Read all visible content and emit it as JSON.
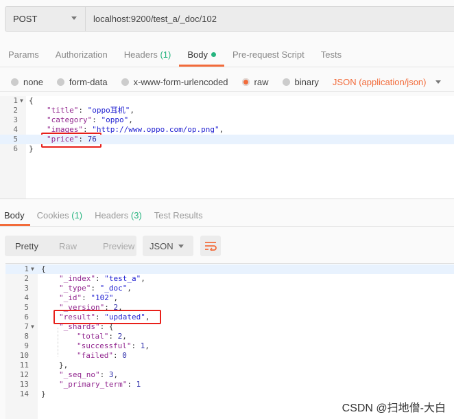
{
  "request": {
    "method": "POST",
    "url": "localhost:9200/test_a/_doc/102"
  },
  "request_tabs": [
    {
      "label": "Params",
      "count": ""
    },
    {
      "label": "Authorization",
      "count": ""
    },
    {
      "label": "Headers",
      "count": "(1)"
    },
    {
      "label": "Body",
      "count": "",
      "active": true,
      "dot": true
    },
    {
      "label": "Pre-request Script",
      "count": ""
    },
    {
      "label": "Tests",
      "count": ""
    }
  ],
  "body_types": [
    {
      "label": "none"
    },
    {
      "label": "form-data"
    },
    {
      "label": "x-www-form-urlencoded"
    },
    {
      "label": "raw",
      "selected": true
    },
    {
      "label": "binary"
    }
  ],
  "content_type": "JSON (application/json)",
  "request_body": [
    {
      "n": "1",
      "fold": true,
      "i": 0,
      "p": "{"
    },
    {
      "n": "2",
      "i": 1,
      "k": "\"title\"",
      "v": "\"oppo耳机\"",
      "t": "s",
      "e": ","
    },
    {
      "n": "3",
      "i": 1,
      "k": "\"category\"",
      "v": "\"oppo\"",
      "t": "s",
      "e": ","
    },
    {
      "n": "4",
      "i": 1,
      "k": "\"images\"",
      "v": "\"http://www.oppo.com/op.png\"",
      "t": "s",
      "e": ","
    },
    {
      "n": "5",
      "i": 1,
      "k": "\"price\"",
      "v": "76",
      "t": "num",
      "e": "",
      "hl": true
    },
    {
      "n": "6",
      "i": 0,
      "p": "}"
    }
  ],
  "response_tabs": [
    {
      "label": "Body",
      "count": "",
      "active": true
    },
    {
      "label": "Cookies",
      "count": "(1)"
    },
    {
      "label": "Headers",
      "count": "(3)"
    },
    {
      "label": "Test Results",
      "count": ""
    }
  ],
  "view_modes": [
    "Pretty",
    "Raw",
    "Preview"
  ],
  "response_format": "JSON",
  "response_body": [
    {
      "n": "1",
      "fold": true,
      "i": 0,
      "p": "{",
      "hl": true
    },
    {
      "n": "2",
      "i": 1,
      "k": "\"_index\"",
      "v": "\"test_a\"",
      "t": "s",
      "e": ","
    },
    {
      "n": "3",
      "i": 1,
      "k": "\"_type\"",
      "v": "\"_doc\"",
      "t": "s",
      "e": ","
    },
    {
      "n": "4",
      "i": 1,
      "k": "\"_id\"",
      "v": "\"102\"",
      "t": "s",
      "e": ","
    },
    {
      "n": "5",
      "i": 1,
      "k": "\"_version\"",
      "v": "2",
      "t": "num",
      "e": ","
    },
    {
      "n": "6",
      "i": 1,
      "k": "\"result\"",
      "v": "\"updated\"",
      "t": "s",
      "e": ","
    },
    {
      "n": "7",
      "fold": true,
      "i": 1,
      "k": "\"_shards\"",
      "v": "{",
      "t": "p",
      "e": ""
    },
    {
      "n": "8",
      "i": 2,
      "k": "\"total\"",
      "v": "2",
      "t": "num",
      "e": ","
    },
    {
      "n": "9",
      "i": 2,
      "k": "\"successful\"",
      "v": "1",
      "t": "num",
      "e": ","
    },
    {
      "n": "10",
      "i": 2,
      "k": "\"failed\"",
      "v": "0",
      "t": "num",
      "e": ""
    },
    {
      "n": "11",
      "i": 1,
      "p": "},"
    },
    {
      "n": "12",
      "i": 1,
      "k": "\"_seq_no\"",
      "v": "3",
      "t": "num",
      "e": ","
    },
    {
      "n": "13",
      "i": 1,
      "k": "\"_primary_term\"",
      "v": "1",
      "t": "num",
      "e": ""
    },
    {
      "n": "14",
      "i": 0,
      "p": "}"
    }
  ],
  "watermark": "CSDN @扫地僧-大白",
  "colors": {
    "accent": "#f26b3a",
    "count": "#26b47f",
    "highlight_box": "#e8201a"
  }
}
